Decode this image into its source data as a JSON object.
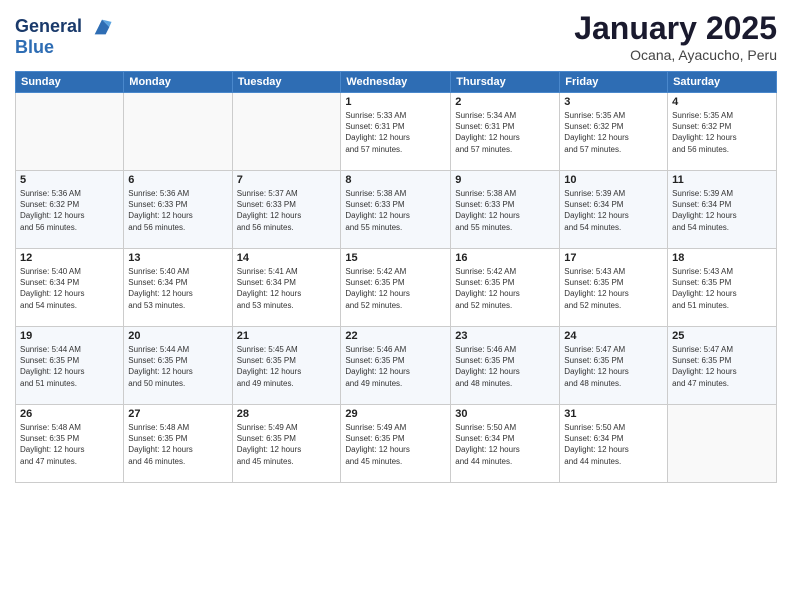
{
  "logo": {
    "line1": "General",
    "line2": "Blue"
  },
  "title": "January 2025",
  "subtitle": "Ocana, Ayacucho, Peru",
  "days_of_week": [
    "Sunday",
    "Monday",
    "Tuesday",
    "Wednesday",
    "Thursday",
    "Friday",
    "Saturday"
  ],
  "weeks": [
    [
      {
        "day": "",
        "info": ""
      },
      {
        "day": "",
        "info": ""
      },
      {
        "day": "",
        "info": ""
      },
      {
        "day": "1",
        "info": "Sunrise: 5:33 AM\nSunset: 6:31 PM\nDaylight: 12 hours\nand 57 minutes."
      },
      {
        "day": "2",
        "info": "Sunrise: 5:34 AM\nSunset: 6:31 PM\nDaylight: 12 hours\nand 57 minutes."
      },
      {
        "day": "3",
        "info": "Sunrise: 5:35 AM\nSunset: 6:32 PM\nDaylight: 12 hours\nand 57 minutes."
      },
      {
        "day": "4",
        "info": "Sunrise: 5:35 AM\nSunset: 6:32 PM\nDaylight: 12 hours\nand 56 minutes."
      }
    ],
    [
      {
        "day": "5",
        "info": "Sunrise: 5:36 AM\nSunset: 6:32 PM\nDaylight: 12 hours\nand 56 minutes."
      },
      {
        "day": "6",
        "info": "Sunrise: 5:36 AM\nSunset: 6:33 PM\nDaylight: 12 hours\nand 56 minutes."
      },
      {
        "day": "7",
        "info": "Sunrise: 5:37 AM\nSunset: 6:33 PM\nDaylight: 12 hours\nand 56 minutes."
      },
      {
        "day": "8",
        "info": "Sunrise: 5:38 AM\nSunset: 6:33 PM\nDaylight: 12 hours\nand 55 minutes."
      },
      {
        "day": "9",
        "info": "Sunrise: 5:38 AM\nSunset: 6:33 PM\nDaylight: 12 hours\nand 55 minutes."
      },
      {
        "day": "10",
        "info": "Sunrise: 5:39 AM\nSunset: 6:34 PM\nDaylight: 12 hours\nand 54 minutes."
      },
      {
        "day": "11",
        "info": "Sunrise: 5:39 AM\nSunset: 6:34 PM\nDaylight: 12 hours\nand 54 minutes."
      }
    ],
    [
      {
        "day": "12",
        "info": "Sunrise: 5:40 AM\nSunset: 6:34 PM\nDaylight: 12 hours\nand 54 minutes."
      },
      {
        "day": "13",
        "info": "Sunrise: 5:40 AM\nSunset: 6:34 PM\nDaylight: 12 hours\nand 53 minutes."
      },
      {
        "day": "14",
        "info": "Sunrise: 5:41 AM\nSunset: 6:34 PM\nDaylight: 12 hours\nand 53 minutes."
      },
      {
        "day": "15",
        "info": "Sunrise: 5:42 AM\nSunset: 6:35 PM\nDaylight: 12 hours\nand 52 minutes."
      },
      {
        "day": "16",
        "info": "Sunrise: 5:42 AM\nSunset: 6:35 PM\nDaylight: 12 hours\nand 52 minutes."
      },
      {
        "day": "17",
        "info": "Sunrise: 5:43 AM\nSunset: 6:35 PM\nDaylight: 12 hours\nand 52 minutes."
      },
      {
        "day": "18",
        "info": "Sunrise: 5:43 AM\nSunset: 6:35 PM\nDaylight: 12 hours\nand 51 minutes."
      }
    ],
    [
      {
        "day": "19",
        "info": "Sunrise: 5:44 AM\nSunset: 6:35 PM\nDaylight: 12 hours\nand 51 minutes."
      },
      {
        "day": "20",
        "info": "Sunrise: 5:44 AM\nSunset: 6:35 PM\nDaylight: 12 hours\nand 50 minutes."
      },
      {
        "day": "21",
        "info": "Sunrise: 5:45 AM\nSunset: 6:35 PM\nDaylight: 12 hours\nand 49 minutes."
      },
      {
        "day": "22",
        "info": "Sunrise: 5:46 AM\nSunset: 6:35 PM\nDaylight: 12 hours\nand 49 minutes."
      },
      {
        "day": "23",
        "info": "Sunrise: 5:46 AM\nSunset: 6:35 PM\nDaylight: 12 hours\nand 48 minutes."
      },
      {
        "day": "24",
        "info": "Sunrise: 5:47 AM\nSunset: 6:35 PM\nDaylight: 12 hours\nand 48 minutes."
      },
      {
        "day": "25",
        "info": "Sunrise: 5:47 AM\nSunset: 6:35 PM\nDaylight: 12 hours\nand 47 minutes."
      }
    ],
    [
      {
        "day": "26",
        "info": "Sunrise: 5:48 AM\nSunset: 6:35 PM\nDaylight: 12 hours\nand 47 minutes."
      },
      {
        "day": "27",
        "info": "Sunrise: 5:48 AM\nSunset: 6:35 PM\nDaylight: 12 hours\nand 46 minutes."
      },
      {
        "day": "28",
        "info": "Sunrise: 5:49 AM\nSunset: 6:35 PM\nDaylight: 12 hours\nand 45 minutes."
      },
      {
        "day": "29",
        "info": "Sunrise: 5:49 AM\nSunset: 6:35 PM\nDaylight: 12 hours\nand 45 minutes."
      },
      {
        "day": "30",
        "info": "Sunrise: 5:50 AM\nSunset: 6:34 PM\nDaylight: 12 hours\nand 44 minutes."
      },
      {
        "day": "31",
        "info": "Sunrise: 5:50 AM\nSunset: 6:34 PM\nDaylight: 12 hours\nand 44 minutes."
      },
      {
        "day": "",
        "info": ""
      }
    ]
  ]
}
